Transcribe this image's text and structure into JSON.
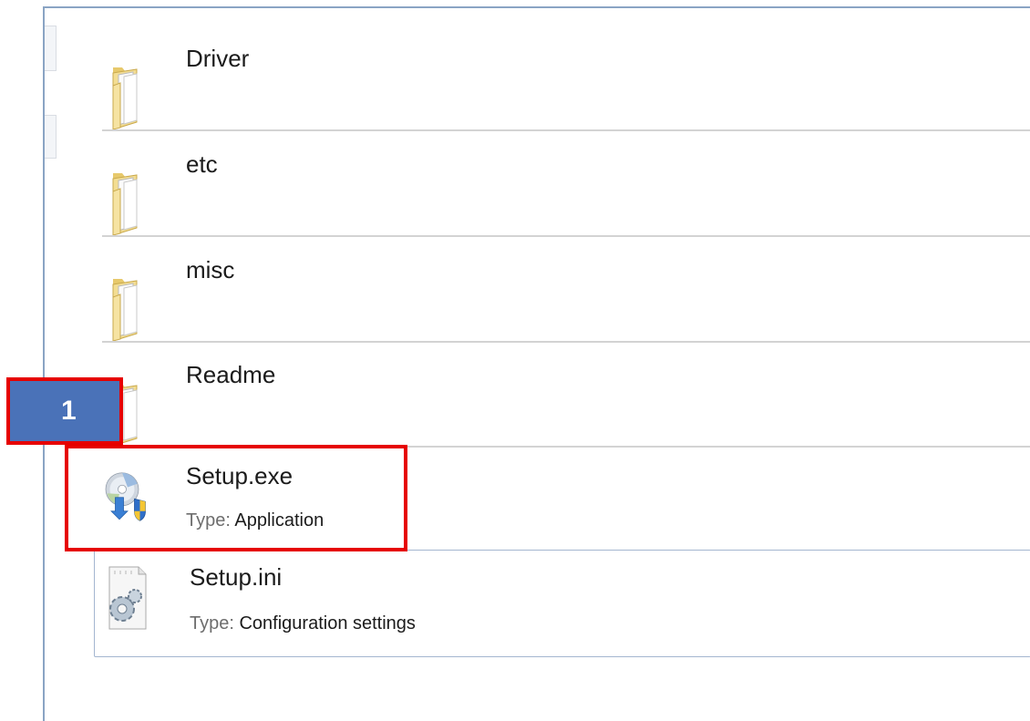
{
  "items": [
    {
      "name": "Driver",
      "kind": "folder"
    },
    {
      "name": "etc",
      "kind": "folder"
    },
    {
      "name": "misc",
      "kind": "folder"
    },
    {
      "name": "Readme",
      "kind": "folder"
    },
    {
      "name": "Setup.exe",
      "kind": "setup-application",
      "type_label": "Type:",
      "type_value": "Application"
    },
    {
      "name": "Setup.ini",
      "kind": "config-file",
      "type_label": "Type:",
      "type_value": "Configuration settings"
    }
  ],
  "annotation": {
    "step_number": "1",
    "highlight_color": "#e60000",
    "badge_color": "#4a72b8"
  },
  "icons": {
    "folder": "folder-icon",
    "setup_application": "setup-disc-shield-icon",
    "config_file": "config-settings-file-icon"
  }
}
